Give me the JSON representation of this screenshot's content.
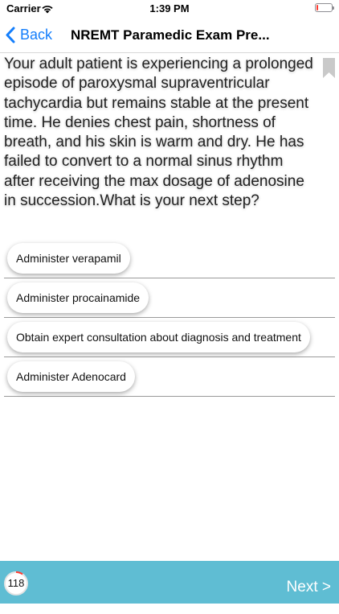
{
  "status_bar": {
    "carrier": "Carrier",
    "time": "1:39 PM",
    "battery_level_percent": 10
  },
  "nav": {
    "back_label": "Back",
    "title": "NREMT Paramedic Exam Pre..."
  },
  "question": {
    "text": "Your adult patient is experiencing a prolonged episode of paroxysmal supraventricular tachycardia but remains stable at the present time. He denies chest pain, shortness of breath, and his skin is warm and dry. He has failed to convert to a normal sinus rhythm after receiving the max dosage of adenosine in succession.What is your next step?"
  },
  "answers": [
    {
      "label": "Administer verapamil"
    },
    {
      "label": "Administer procainamide"
    },
    {
      "label": "Obtain expert consultation about diagnosis and treatment"
    },
    {
      "label": "Administer Adenocard"
    }
  ],
  "bottom_bar": {
    "counter": "118",
    "next_label": "Next >"
  },
  "colors": {
    "accent_blue": "#147efb",
    "bottom_bar": "#5fbdd3",
    "counter_progress": "#ff3b30"
  },
  "icons": {
    "back": "chevron-left-icon",
    "bookmark": "bookmark-icon",
    "wifi": "wifi-icon",
    "battery": "battery-icon"
  }
}
